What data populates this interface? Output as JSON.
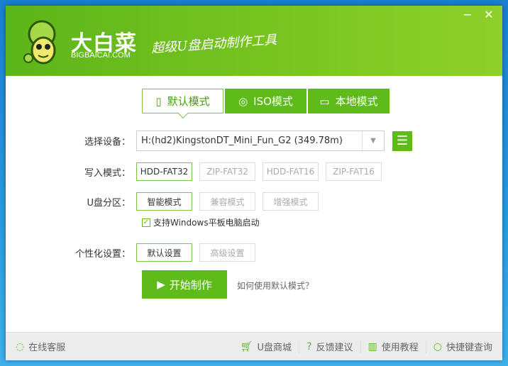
{
  "header": {
    "brand": "大白菜",
    "domain": "BIGBAICAI.COM",
    "slogan": "超级U盘启动制作工具",
    "minimize": "−",
    "close": "✕"
  },
  "tabs": [
    {
      "label": "默认模式",
      "icon": "usb-icon"
    },
    {
      "label": "ISO模式",
      "icon": "disc-icon"
    },
    {
      "label": "本地模式",
      "icon": "monitor-icon"
    }
  ],
  "device": {
    "label": "选择设备：",
    "value": "H:(hd2)KingstonDT_Mini_Fun_G2 (349.78m)"
  },
  "write_mode": {
    "label": "写入模式：",
    "options": [
      "HDD-FAT32",
      "ZIP-FAT32",
      "HDD-FAT16",
      "ZIP-FAT16"
    ],
    "selected": "HDD-FAT32"
  },
  "partition": {
    "label": "U盘分区：",
    "options": [
      "智能模式",
      "兼容模式",
      "增强模式"
    ],
    "selected": "智能模式"
  },
  "windows_tablet": {
    "label": "支持Windows平板电脑启动",
    "checked": true
  },
  "personal": {
    "label": "个性化设置：",
    "options": [
      "默认设置",
      "高级设置"
    ],
    "selected": "默认设置"
  },
  "start_button": "开始制作",
  "help_link": "如何使用默认模式？",
  "footer": {
    "service": "在线客服",
    "shop": "U盘商城",
    "feedback": "反馈建议",
    "tutorial": "使用教程",
    "shortcuts": "快捷键查询"
  }
}
